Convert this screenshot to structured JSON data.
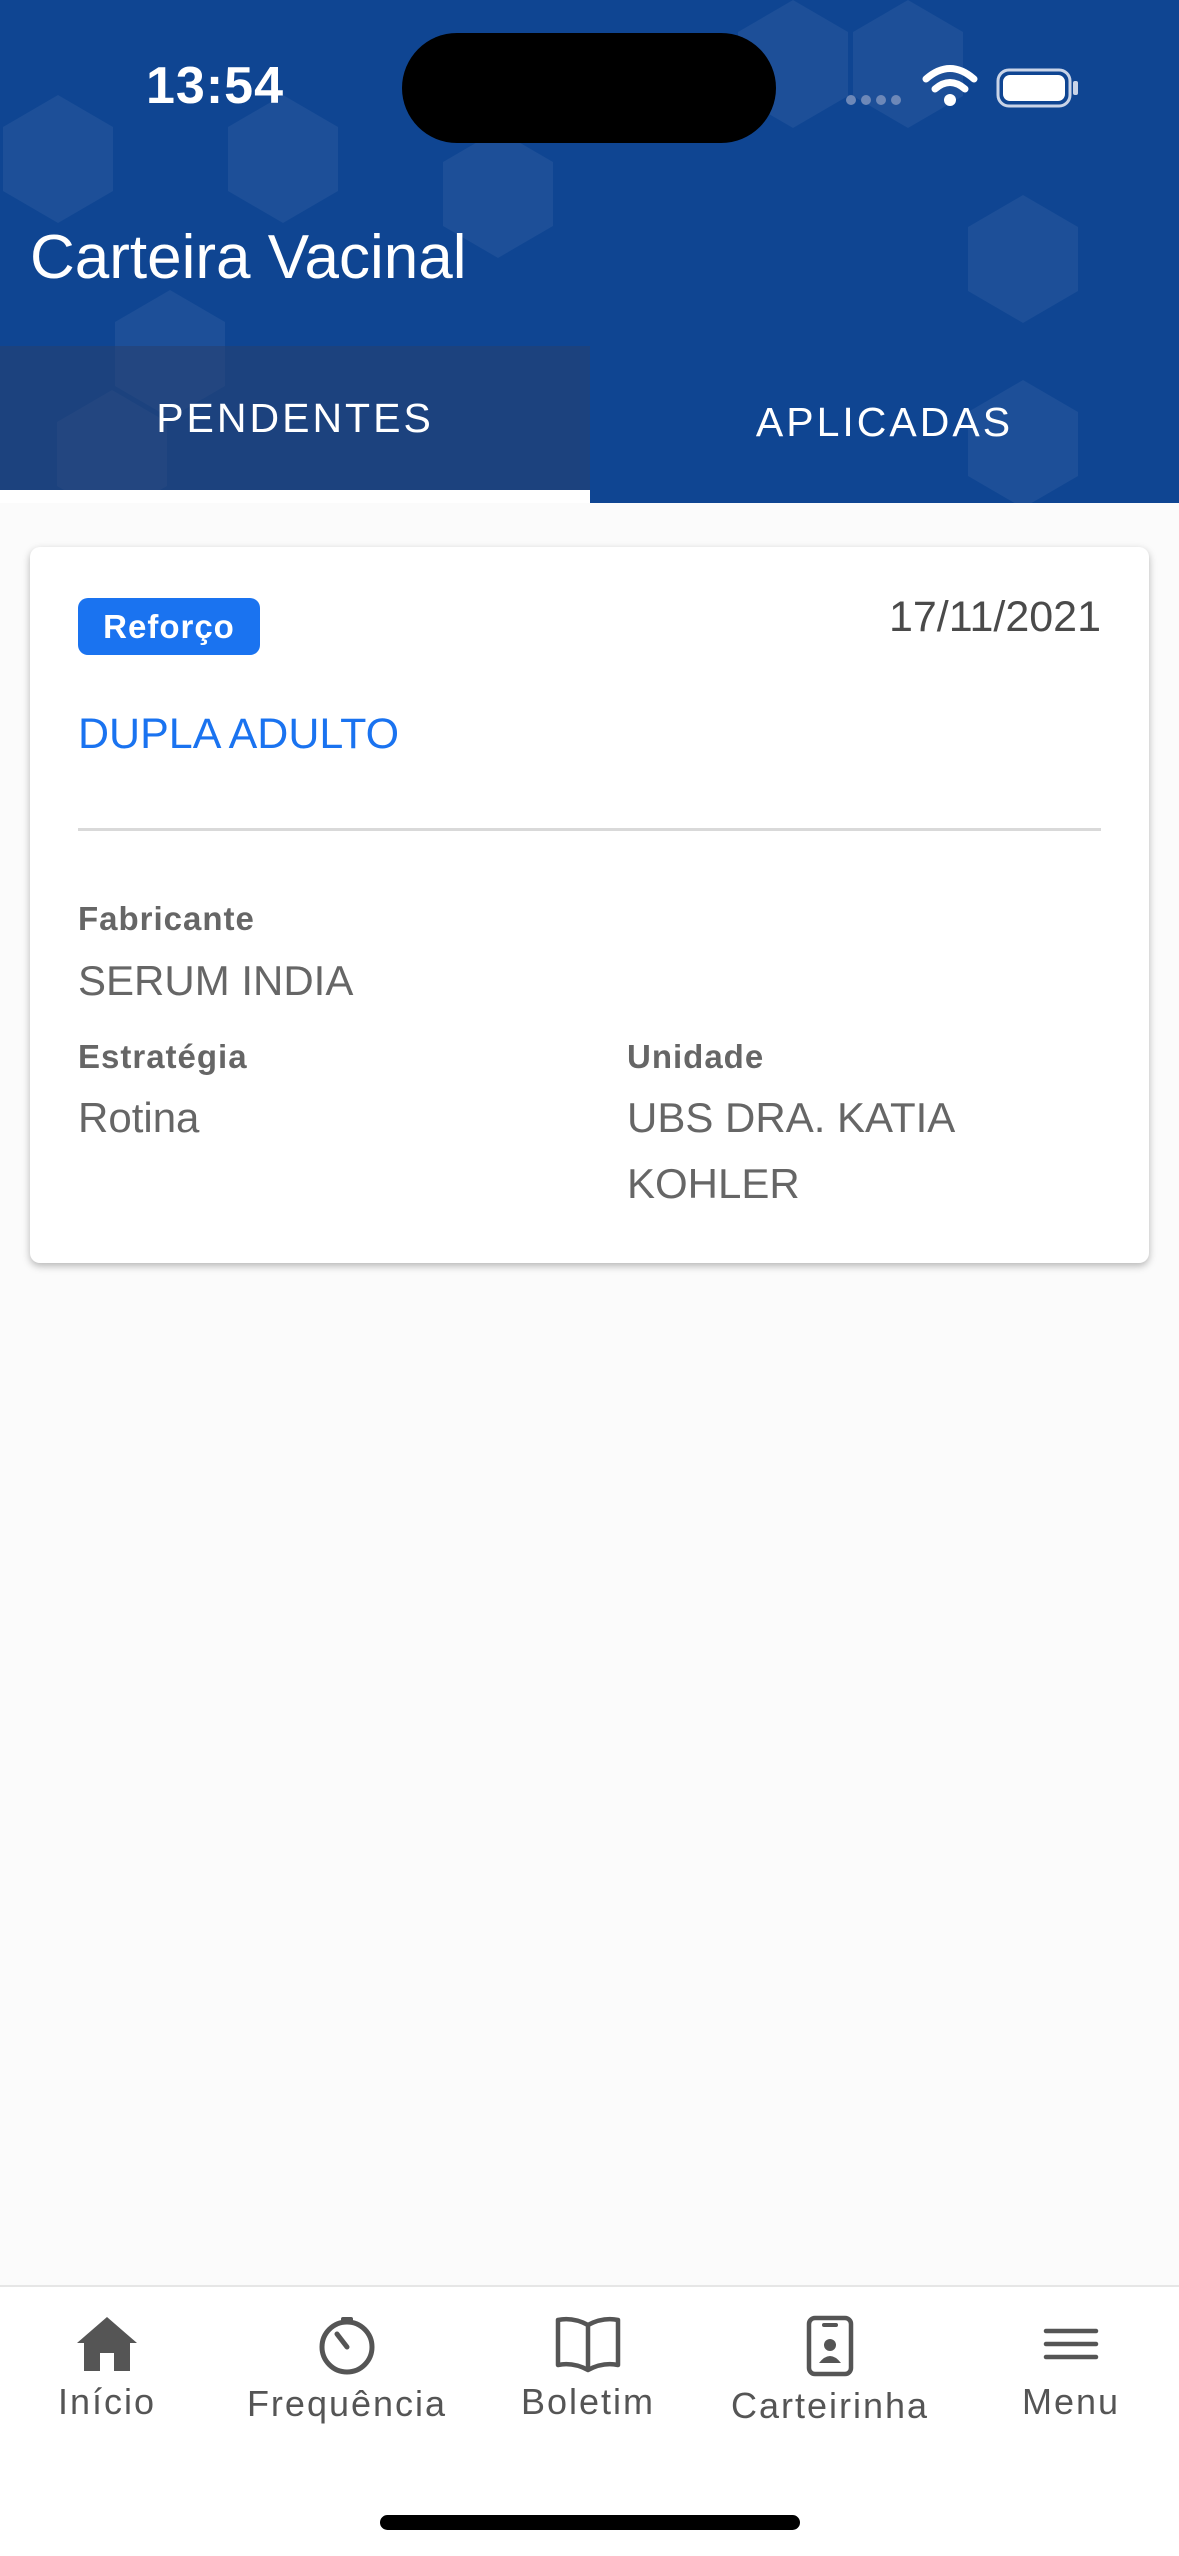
{
  "status_bar": {
    "time": "13:54"
  },
  "header": {
    "title": "Carteira Vacinal",
    "colors": {
      "background": "#0f4592",
      "tab_active_bg": "#28406e",
      "indicator": "#ffffff"
    }
  },
  "tabs": [
    {
      "label": "PENDENTES",
      "active": true
    },
    {
      "label": "APLICADAS",
      "active": false
    }
  ],
  "card": {
    "badge": "Reforço",
    "date": "17/11/2021",
    "vaccine": "DUPLA ADULTO",
    "fabricante_label": "Fabricante",
    "fabricante_value": "SERUM INDIA",
    "estrategia_label": "Estratégia",
    "estrategia_value": "Rotina",
    "unidade_label": "Unidade",
    "unidade_value": "UBS DRA. KATIA KOHLER",
    "colors": {
      "accent": "#1a73f0"
    }
  },
  "bottom_nav": [
    {
      "label": "Início",
      "icon": "home-icon"
    },
    {
      "label": "Frequência",
      "icon": "gauge-icon"
    },
    {
      "label": "Boletim",
      "icon": "book-icon"
    },
    {
      "label": "Carteirinha",
      "icon": "id-card-icon"
    },
    {
      "label": "Menu",
      "icon": "menu-icon"
    }
  ]
}
